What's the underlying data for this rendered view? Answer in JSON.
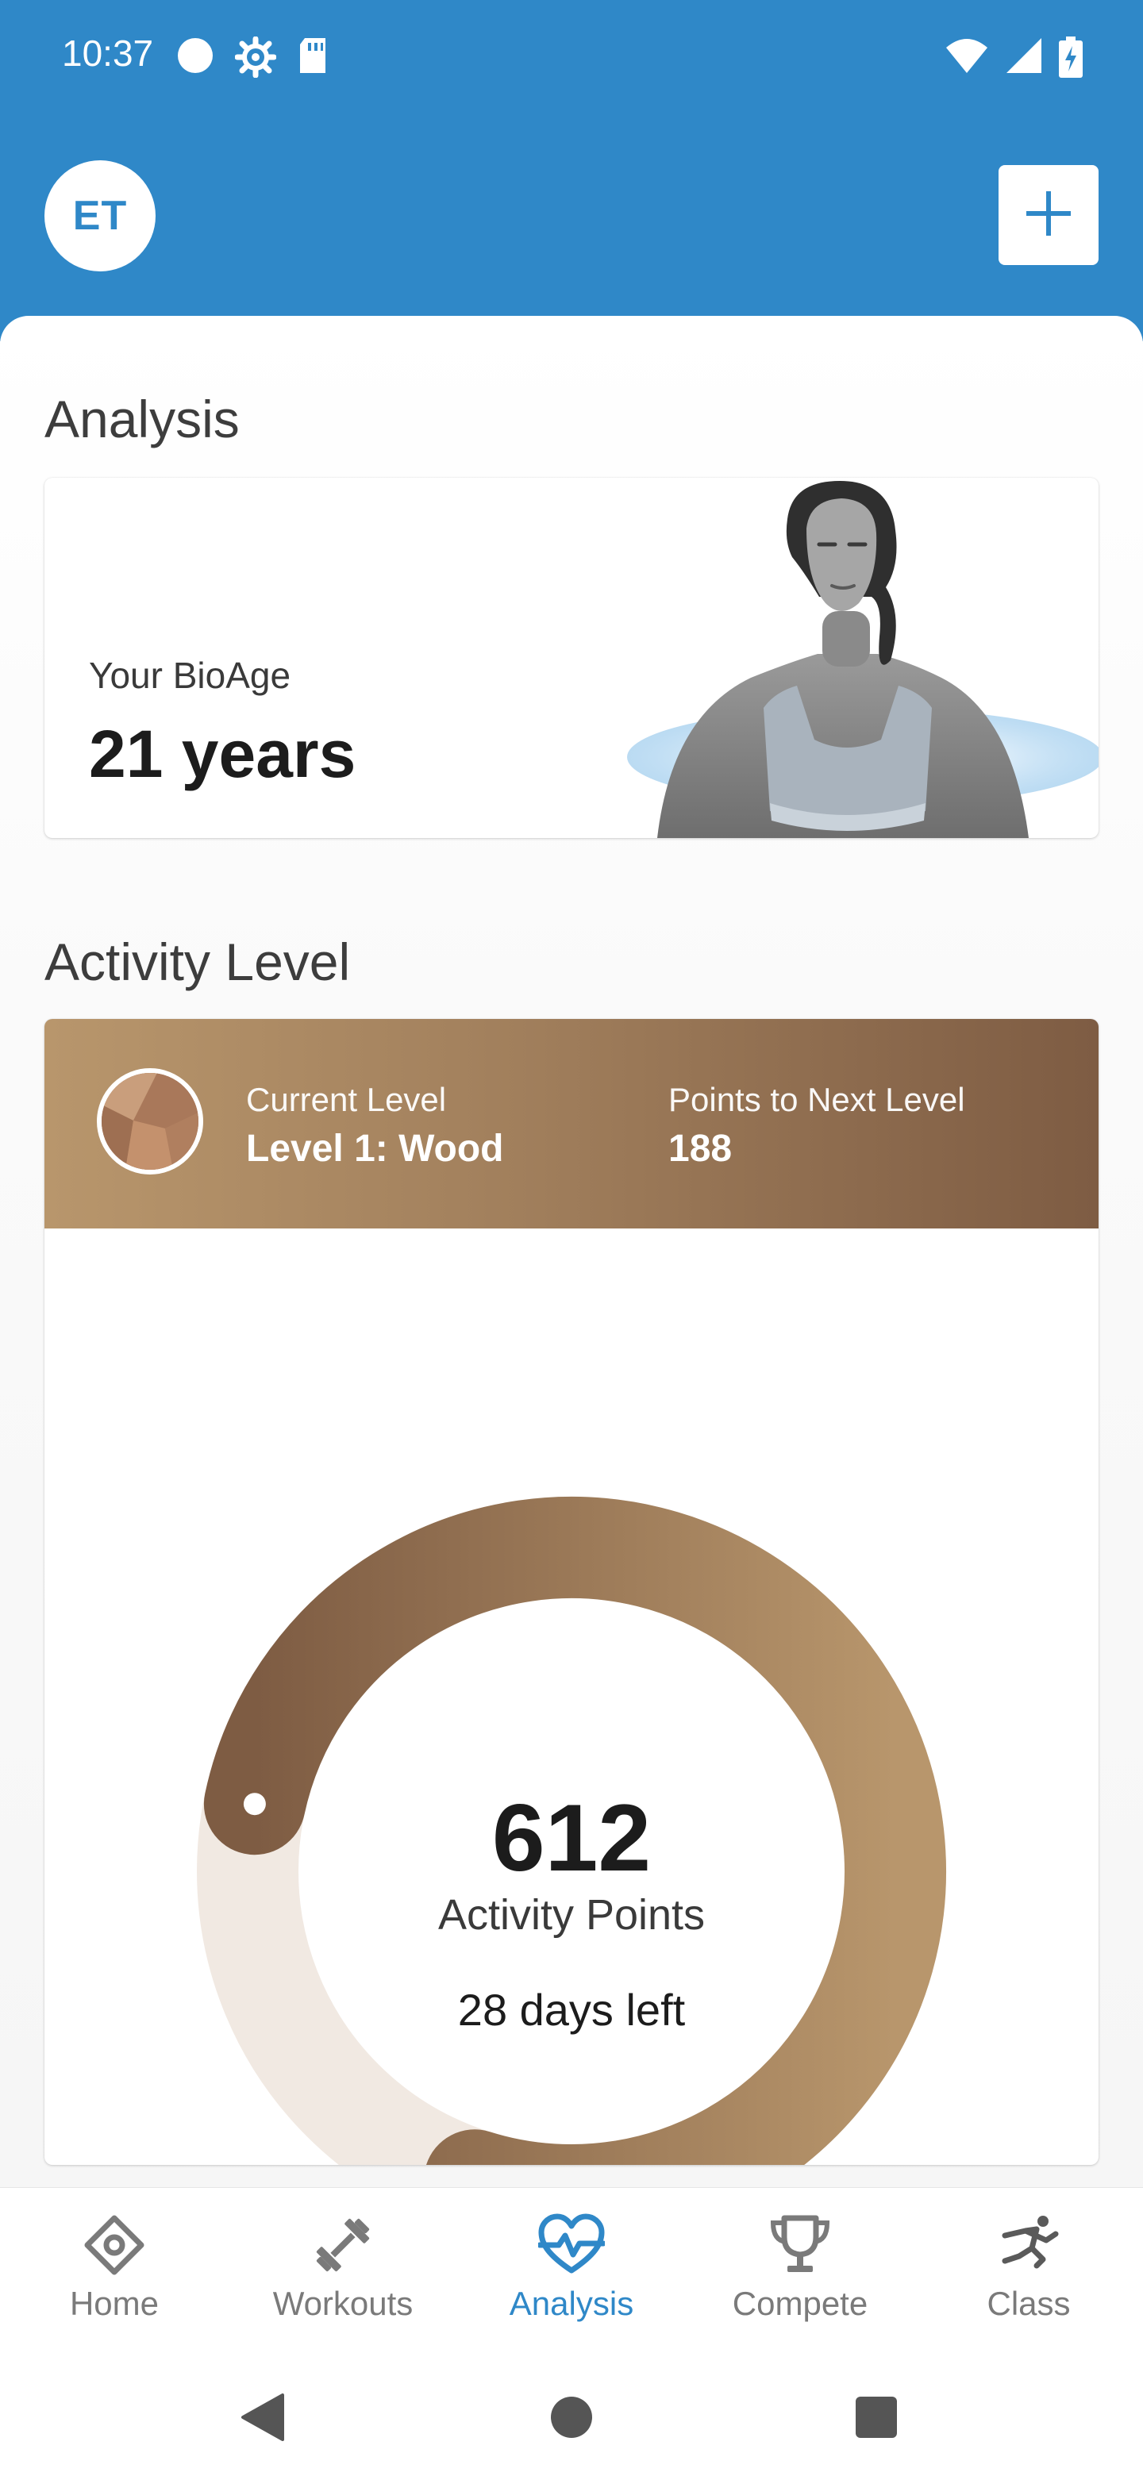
{
  "status_bar": {
    "time": "10:37",
    "left_icons": [
      "circle-icon",
      "settings-icon",
      "sd-card-icon"
    ],
    "right_icons": [
      "wifi-icon",
      "signal-icon",
      "battery-charging-icon"
    ]
  },
  "header": {
    "avatar_initials": "ET",
    "add_icon": "plus-icon",
    "background_color": "#2f88c8"
  },
  "analysis": {
    "section_title": "Analysis",
    "bioage_label": "Your BioAge",
    "bioage_value": "21 years"
  },
  "activity": {
    "section_title": "Activity Level",
    "current_level_label": "Current Level",
    "current_level_value": "Level 1: Wood",
    "next_level_label": "Points to Next Level",
    "next_level_value": "188",
    "points": "612",
    "points_caption": "Activity Points",
    "days_left": "28 days left",
    "progress_fraction": 0.765,
    "colors": {
      "ring_start": "#7e5c43",
      "ring_end": "#b8966c",
      "track": "#f1e9e2"
    }
  },
  "bottom_nav": {
    "items": [
      {
        "label": "Home",
        "icon": "home-diamond-icon"
      },
      {
        "label": "Workouts",
        "icon": "dumbbell-icon"
      },
      {
        "label": "Analysis",
        "icon": "heart-pulse-icon"
      },
      {
        "label": "Compete",
        "icon": "trophy-icon"
      },
      {
        "label": "Class",
        "icon": "running-person-icon"
      }
    ],
    "active_index": 2,
    "active_color": "#2f88c8",
    "inactive_color": "#7a7a7a"
  },
  "system_nav": {
    "icons": [
      "back-icon",
      "home-circle-icon",
      "recents-icon"
    ]
  }
}
